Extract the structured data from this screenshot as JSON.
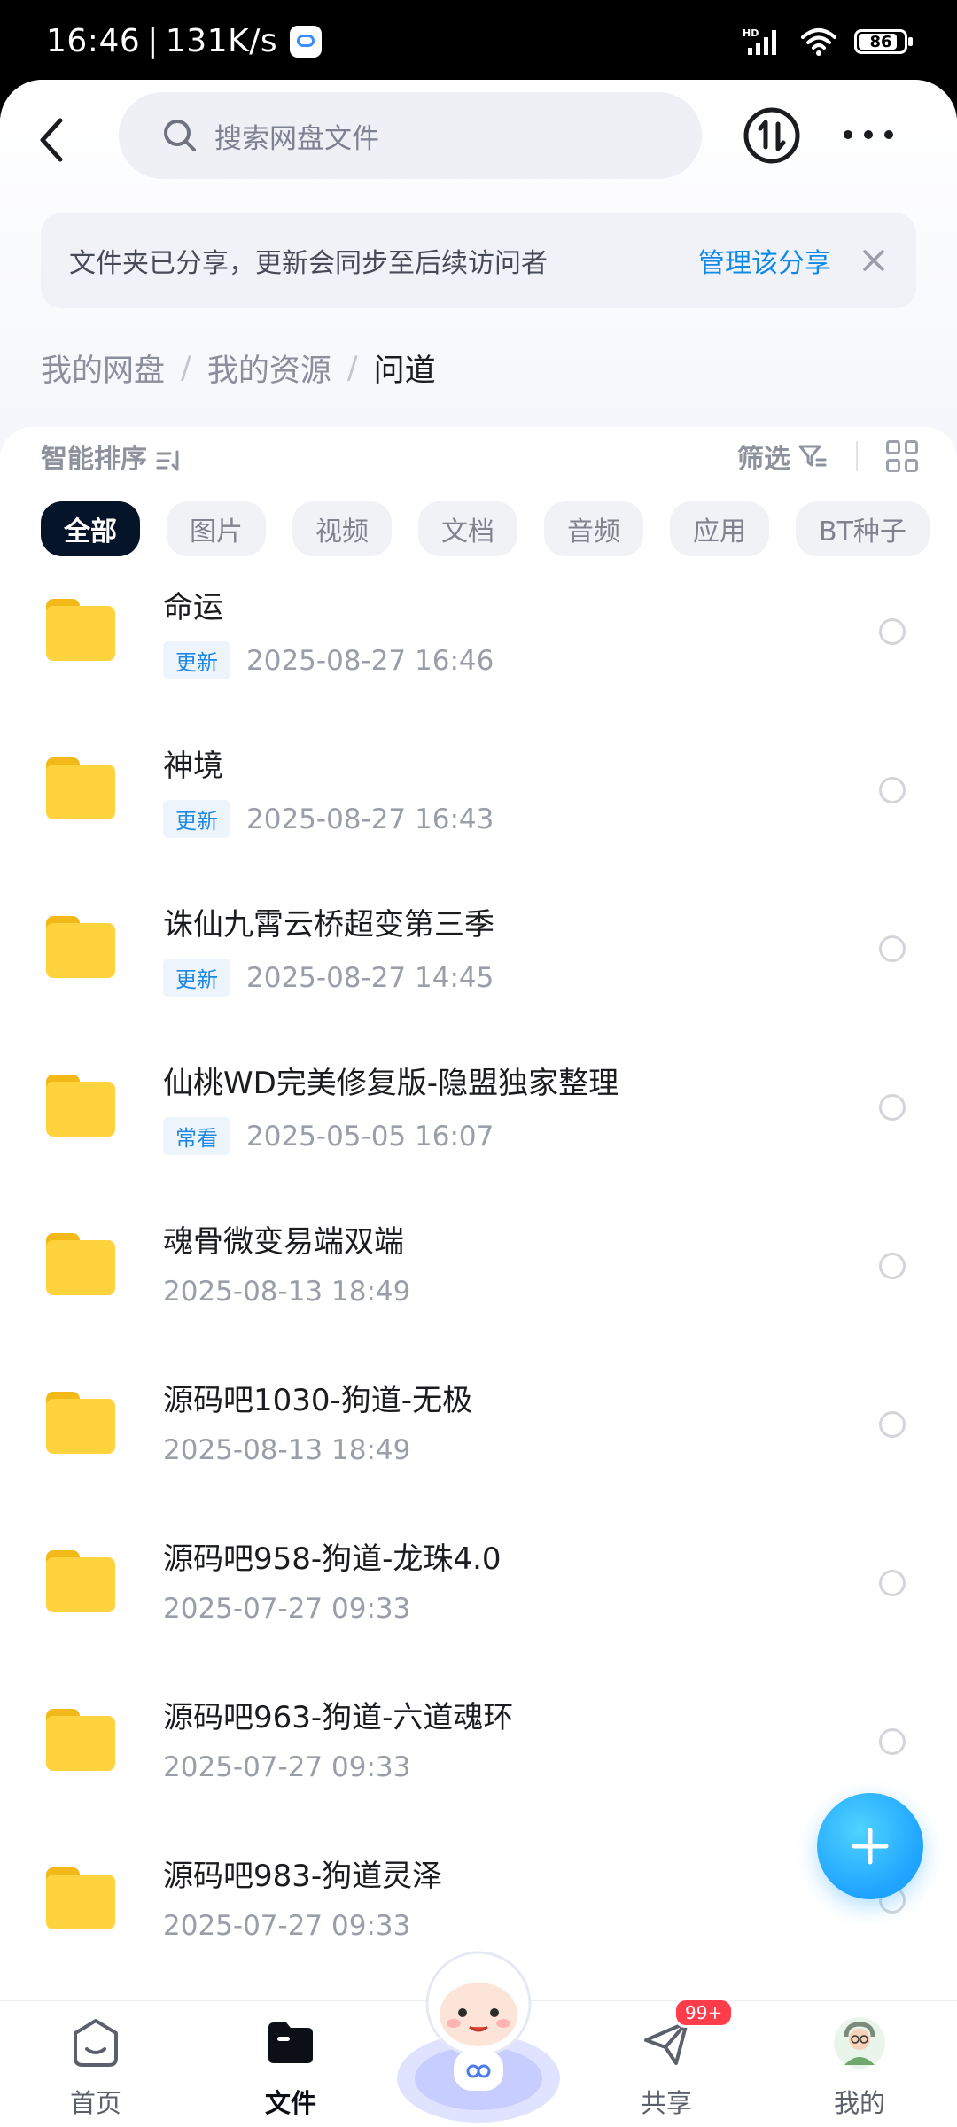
{
  "status_bar": {
    "time": "16:46",
    "speed": "131K/s",
    "network": "HD",
    "battery": "86"
  },
  "header": {
    "search_placeholder": "搜索网盘文件"
  },
  "banner": {
    "message": "文件夹已分享，更新会同步至后续访问者",
    "action": "管理该分享"
  },
  "breadcrumb": {
    "items": [
      "我的网盘",
      "我的资源"
    ],
    "current": "问道"
  },
  "toolbar": {
    "sort_label": "智能排序",
    "filter_label": "筛选"
  },
  "chips": [
    "全部",
    "图片",
    "视频",
    "文档",
    "音频",
    "应用",
    "BT种子"
  ],
  "files": [
    {
      "name": "命运",
      "tag": "更新",
      "date": "2025-08-27  16:46"
    },
    {
      "name": "神境",
      "tag": "更新",
      "date": "2025-08-27  16:43"
    },
    {
      "name": "诛仙九霄云桥超变第三季",
      "tag": "更新",
      "date": "2025-08-27  14:45"
    },
    {
      "name": "仙桃WD完美修复版-隐盟独家整理",
      "tag": "常看",
      "date": "2025-05-05  16:07"
    },
    {
      "name": "魂骨微变易端双端",
      "tag": "",
      "date": "2025-08-13  18:49"
    },
    {
      "name": "源码吧1030-狗道-无极",
      "tag": "",
      "date": "2025-08-13  18:49"
    },
    {
      "name": "源码吧958-狗道-龙珠4.0",
      "tag": "",
      "date": "2025-07-27  09:33"
    },
    {
      "name": "源码吧963-狗道-六道魂环",
      "tag": "",
      "date": "2025-07-27  09:33"
    },
    {
      "name": "源码吧983-狗道灵泽",
      "tag": "",
      "date": "2025-07-27  09:33"
    }
  ],
  "bottom_nav": {
    "home": "首页",
    "files": "文件",
    "share": "共享",
    "share_badge": "99+",
    "mine": "我的"
  },
  "colors": {
    "accent": "#0f89e6",
    "chip_active": "#06142a",
    "folder": "#ffd33d",
    "fab": "#1ea3ff",
    "badge": "#ff3c4a"
  }
}
